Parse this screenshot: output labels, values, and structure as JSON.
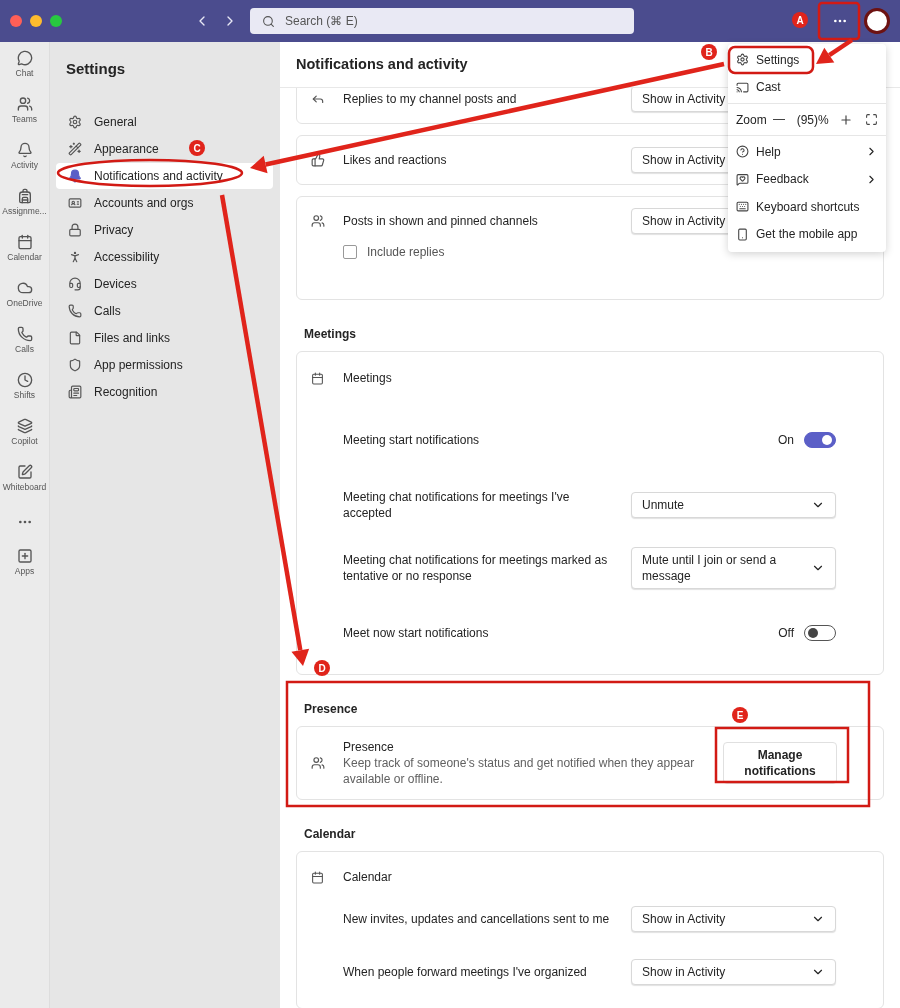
{
  "window": {
    "search_placeholder": "Search (⌘ E)"
  },
  "rail": {
    "items": [
      "Chat",
      "Teams",
      "Activity",
      "Assignme...",
      "Calendar",
      "OneDrive",
      "Calls",
      "Shifts",
      "Copilot",
      "Whiteboard"
    ],
    "apps": "Apps"
  },
  "sidebar": {
    "title": "Settings",
    "items": [
      {
        "label": "General",
        "selected": false
      },
      {
        "label": "Appearance",
        "selected": false
      },
      {
        "label": "Notifications and activity",
        "selected": true
      },
      {
        "label": "Accounts and orgs",
        "selected": false
      },
      {
        "label": "Privacy",
        "selected": false
      },
      {
        "label": "Accessibility",
        "selected": false
      },
      {
        "label": "Devices",
        "selected": false
      },
      {
        "label": "Calls",
        "selected": false
      },
      {
        "label": "Files and links",
        "selected": false
      },
      {
        "label": "App permissions",
        "selected": false
      },
      {
        "label": "Recognition",
        "selected": false
      }
    ]
  },
  "main": {
    "title": "Notifications and activity",
    "top_cards": [
      {
        "label": "Replies to my channel posts and",
        "value": "Show in Activity"
      },
      {
        "label": "Likes and reactions",
        "value": "Show in Activity"
      },
      {
        "label": "Posts in shown and pinned channels",
        "value": "Show in Activity",
        "checkbox": {
          "label": "Include replies",
          "checked": false
        }
      }
    ],
    "sections": [
      {
        "kind": "list",
        "heading": "Meetings",
        "card_title": "Meetings",
        "rows": [
          {
            "kind": "toggle",
            "label": "Meeting start notifications",
            "on": true,
            "state_label": "On"
          },
          {
            "kind": "dropdown",
            "label": "Meeting chat notifications for meetings I've accepted",
            "value": "Unmute"
          },
          {
            "kind": "dropdown",
            "label": "Meeting chat notifications for meetings marked as tentative or no response",
            "value": "Mute until I join or send a message"
          },
          {
            "kind": "toggle",
            "label": "Meet now start notifications",
            "on": false,
            "state_label": "Off"
          }
        ]
      },
      {
        "kind": "action",
        "heading": "Presence",
        "title": "Presence",
        "description": "Keep track of someone's status and get notified when they appear available or offline.",
        "button": "Manage notifications"
      },
      {
        "kind": "list",
        "heading": "Calendar",
        "card_title": "Calendar",
        "rows": [
          {
            "kind": "dropdown",
            "label": "New invites, updates and cancellations sent to me",
            "value": "Show in Activity"
          },
          {
            "kind": "dropdown",
            "label": "When people forward meetings I've organized",
            "value": "Show in Activity"
          }
        ]
      }
    ]
  },
  "menu": {
    "items": [
      {
        "kind": "item",
        "label": "Settings",
        "submenu": false
      },
      {
        "kind": "item",
        "label": "Cast",
        "submenu": false
      },
      {
        "kind": "zoom",
        "label": "Zoom",
        "value": "(95)%"
      },
      {
        "kind": "item",
        "label": "Help",
        "submenu": true
      },
      {
        "kind": "item",
        "label": "Feedback",
        "submenu": true
      },
      {
        "kind": "item",
        "label": "Keyboard shortcuts",
        "submenu": false
      },
      {
        "kind": "item",
        "label": "Get the mobile app",
        "submenu": false
      }
    ]
  },
  "annotations": {
    "markers": [
      "A",
      "B",
      "C",
      "D",
      "E"
    ]
  }
}
